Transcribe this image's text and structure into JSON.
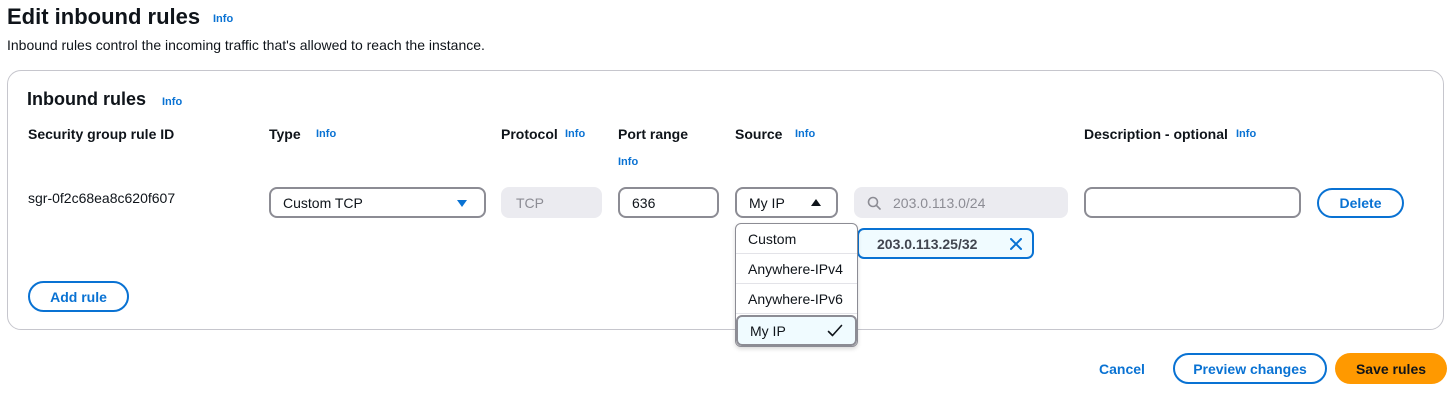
{
  "page": {
    "title": "Edit inbound rules",
    "info": "Info",
    "description": "Inbound rules control the incoming traffic that's allowed to reach the instance."
  },
  "panel": {
    "title": "Inbound rules",
    "info": "Info"
  },
  "columns": {
    "rule_id": "Security group rule ID",
    "type": "Type",
    "type_info": "Info",
    "protocol": "Protocol",
    "protocol_info": "Info",
    "port_range": "Port range",
    "port_range_info": "Info",
    "source": "Source",
    "source_info": "Info",
    "description": "Description - optional",
    "description_info": "Info"
  },
  "rule": {
    "id": "sgr-0f2c68ea8c620f607",
    "type": "Custom TCP",
    "protocol": "TCP",
    "port_range": "636",
    "source": "My IP",
    "cidr_placeholder": "203.0.113.0/24",
    "cidr_token": "203.0.113.25/32",
    "description": "",
    "delete_label": "Delete"
  },
  "source_dropdown": {
    "options": [
      "Custom",
      "Anywhere-IPv4",
      "Anywhere-IPv6",
      "My IP"
    ],
    "selected": "My IP"
  },
  "buttons": {
    "add_rule": "Add rule",
    "cancel": "Cancel",
    "preview": "Preview changes",
    "save": "Save rules"
  },
  "colors": {
    "link": "#0972d3",
    "primary": "#ff9900",
    "border": "#8c8c94"
  }
}
